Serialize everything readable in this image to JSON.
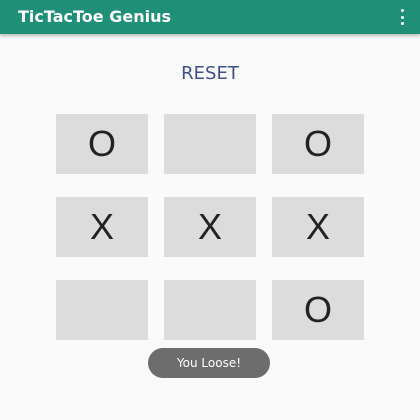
{
  "app": {
    "title": "TicTacToe Genius",
    "colors": {
      "primary": "#1f8f78",
      "reset_text": "#3f4f8c",
      "cell_bg": "#dcdcdc",
      "toast_bg": "#6d6d6d"
    },
    "icons": {
      "overflow": "more-vert-icon"
    }
  },
  "controls": {
    "reset_label": "RESET"
  },
  "board": {
    "cells": [
      "O",
      "",
      "O",
      "X",
      "X",
      "X",
      "",
      "",
      "O"
    ]
  },
  "toast": {
    "message": "You Loose!"
  }
}
